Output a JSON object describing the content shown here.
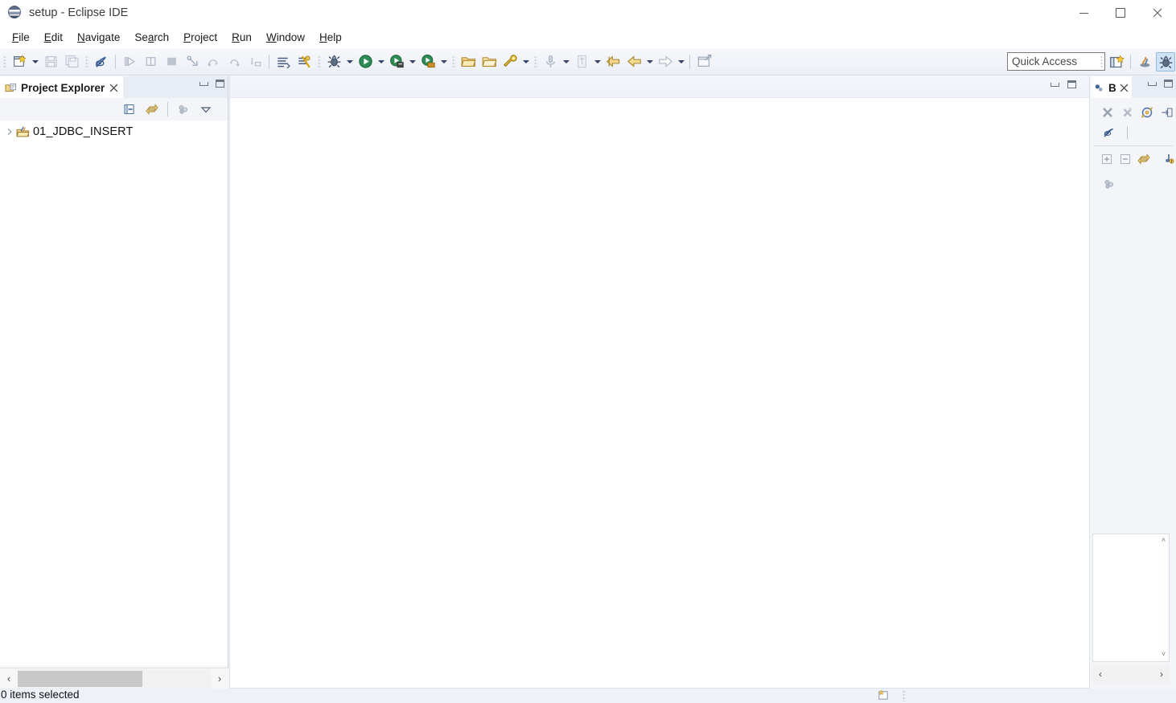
{
  "window": {
    "title": "setup - Eclipse IDE",
    "icon": "eclipse-globe-icon",
    "minimize_label": "Minimize",
    "maximize_label": "Maximize",
    "close_label": "Close"
  },
  "menubar": {
    "items": [
      {
        "label": "File",
        "mnemonic": "F"
      },
      {
        "label": "Edit",
        "mnemonic": "E"
      },
      {
        "label": "Navigate",
        "mnemonic": "N"
      },
      {
        "label": "Search",
        "mnemonic": "a"
      },
      {
        "label": "Project",
        "mnemonic": "P"
      },
      {
        "label": "Run",
        "mnemonic": "R"
      },
      {
        "label": "Window",
        "mnemonic": "W"
      },
      {
        "label": "Help",
        "mnemonic": "H"
      }
    ]
  },
  "toolbar": {
    "icons": [
      "new-wizard-icon",
      "save-icon",
      "save-all-icon",
      "toggle-mark-occurrences-icon",
      "resume-icon",
      "suspend-icon",
      "terminate-icon",
      "step-into-icon",
      "step-over-icon",
      "step-return-icon",
      "drop-to-frame-icon",
      "open-console-icon",
      "skip-breakpoints-icon",
      "debug-icon",
      "run-icon",
      "run-external-tools-icon",
      "coverage-icon",
      "new-java-project-icon",
      "open-type-icon",
      "search-icon",
      "open-task-icon",
      "previous-annotation-icon",
      "back-icon",
      "forward-icon",
      "new-window-icon"
    ]
  },
  "quick_access": {
    "placeholder": "Quick Access",
    "value": "Quick Access"
  },
  "perspectives": {
    "open_perspective_label": "Open Perspective",
    "items": [
      "java-perspective-icon",
      "debug-perspective-icon"
    ]
  },
  "project_explorer": {
    "tab_label": "Project Explorer",
    "tab_icon": "project-explorer-icon",
    "close_label": "✕",
    "toolbar_icons": [
      "collapse-all-icon",
      "link-with-editor-icon",
      "focus-active-task-icon",
      "view-menu-icon"
    ],
    "tree": [
      {
        "label": "01_JDBC_INSERT",
        "icon": "java-project-icon",
        "expanded": false
      }
    ],
    "scrollbar": {
      "left_arrow": "‹",
      "right_arrow": "›"
    }
  },
  "editor": {
    "content": "",
    "minimize_label": "Minimize",
    "maximize_label": "Maximize"
  },
  "right_top_view": {
    "tab_label": "B",
    "tab_icon": "breakpoints-icon",
    "close_label": "✕",
    "toolbar_icons": [
      "remove-breakpoint-icon",
      "remove-all-breakpoints-icon",
      "link-with-debug-view-icon",
      "show-in-editor-icon",
      "skip-all-breakpoints-icon",
      "expand-all-icon",
      "collapse-all-icon",
      "link-icon",
      "add-java-exception-breakpoint-icon",
      "focus-active-task-icon",
      "view-menu-icon"
    ]
  },
  "right_bottom_view": {
    "scrollbar": {
      "up_arrow": "˄",
      "down_arrow": "˅",
      "left_arrow": "‹",
      "right_arrow": "›"
    }
  },
  "statusbar": {
    "message": "0 items selected",
    "icon": "editor-state-icon"
  },
  "colors": {
    "accent_yellow": "#f0c040",
    "run_green": "#2e8b57",
    "tab_active_bg": "#ffffff",
    "panel_bg": "#f3f5f9",
    "chrome_bg": "#eef1f7",
    "border": "#cfd5e0"
  }
}
